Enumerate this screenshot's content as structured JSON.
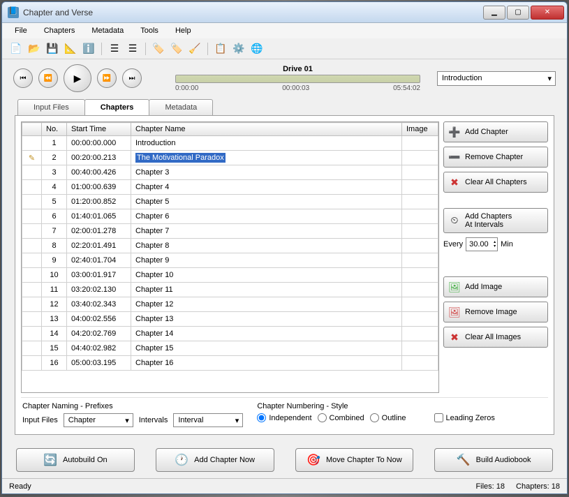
{
  "window": {
    "title": "Chapter and Verse"
  },
  "menu": {
    "file": "File",
    "chapters": "Chapters",
    "metadata": "Metadata",
    "tools": "Tools",
    "help": "Help"
  },
  "play": {
    "title": "Drive 01",
    "t0": "0:00:00",
    "t1": "00:00:03",
    "t2": "05:54:02",
    "dropdown": "Introduction"
  },
  "tabs": {
    "input": "Input Files",
    "chapters": "Chapters",
    "metadata": "Metadata"
  },
  "grid": {
    "cols": {
      "no": "No.",
      "start": "Start Time",
      "name": "Chapter Name",
      "image": "Image"
    },
    "rows": [
      {
        "no": "1",
        "start": "00:00:00.000",
        "name": "Introduction"
      },
      {
        "no": "2",
        "start": "00:20:00.213",
        "name": "The Motivational Paradox"
      },
      {
        "no": "3",
        "start": "00:40:00.426",
        "name": "Chapter 3"
      },
      {
        "no": "4",
        "start": "01:00:00.639",
        "name": "Chapter 4"
      },
      {
        "no": "5",
        "start": "01:20:00.852",
        "name": "Chapter 5"
      },
      {
        "no": "6",
        "start": "01:40:01.065",
        "name": "Chapter 6"
      },
      {
        "no": "7",
        "start": "02:00:01.278",
        "name": "Chapter 7"
      },
      {
        "no": "8",
        "start": "02:20:01.491",
        "name": "Chapter 8"
      },
      {
        "no": "9",
        "start": "02:40:01.704",
        "name": "Chapter 9"
      },
      {
        "no": "10",
        "start": "03:00:01.917",
        "name": "Chapter 10"
      },
      {
        "no": "11",
        "start": "03:20:02.130",
        "name": "Chapter 11"
      },
      {
        "no": "12",
        "start": "03:40:02.343",
        "name": "Chapter 12"
      },
      {
        "no": "13",
        "start": "04:00:02.556",
        "name": "Chapter 13"
      },
      {
        "no": "14",
        "start": "04:20:02.769",
        "name": "Chapter 14"
      },
      {
        "no": "15",
        "start": "04:40:02.982",
        "name": "Chapter 15"
      },
      {
        "no": "16",
        "start": "05:00:03.195",
        "name": "Chapter 16"
      }
    ]
  },
  "side": {
    "add_chapter": "Add Chapter",
    "remove_chapter": "Remove Chapter",
    "clear_chapters": "Clear All Chapters",
    "add_intervals_l1": "Add Chapters",
    "add_intervals_l2": "At Intervals",
    "every": "Every",
    "interval_value": "30.00",
    "min": "Min",
    "add_image": "Add Image",
    "remove_image": "Remove Image",
    "clear_images": "Clear All Images"
  },
  "naming": {
    "group": "Chapter Naming - Prefixes",
    "input_files_label": "Input Files",
    "input_files_value": "Chapter",
    "intervals_label": "Intervals",
    "intervals_value": "Interval"
  },
  "numbering": {
    "group": "Chapter Numbering - Style",
    "independent": "Independent",
    "combined": "Combined",
    "outline": "Outline",
    "leading_zeros": "Leading Zeros"
  },
  "bottom": {
    "autobuild": "Autobuild On",
    "add_now": "Add Chapter Now",
    "move_now": "Move Chapter To Now",
    "build": "Build Audiobook"
  },
  "status": {
    "ready": "Ready",
    "files": "Files: 18",
    "chapters": "Chapters: 18"
  }
}
